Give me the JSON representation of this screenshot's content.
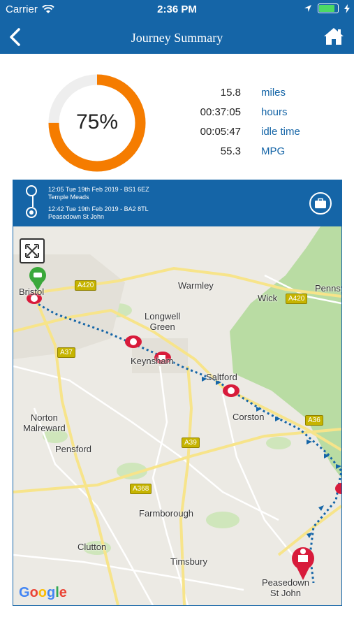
{
  "status_bar": {
    "carrier": "Carrier",
    "time": "2:36 PM",
    "battery_level": 0.9
  },
  "nav": {
    "title": "Journey Summary",
    "back_icon": "chevron-left-icon",
    "home_icon": "home-icon"
  },
  "gauge": {
    "label": "75%",
    "value": 0.75,
    "color": "#f57c00",
    "track_color": "#eeeeee"
  },
  "stats": [
    {
      "value": "15.8",
      "unit": "miles"
    },
    {
      "value": "00:37:05",
      "unit": "hours"
    },
    {
      "value": "00:05:47",
      "unit": "idle time"
    },
    {
      "value": "55.3",
      "unit": "MPG"
    }
  ],
  "route": {
    "start": {
      "time": "12:05 Tue 19th Feb 2019 - BS1 6EZ",
      "place": "Temple Meads"
    },
    "end": {
      "time": "12:42 Tue 19th Feb 2019 - BA2 8TL",
      "place": "Peasedown St John"
    },
    "briefcase_icon": "briefcase-icon"
  },
  "map": {
    "places": {
      "bristol": "Bristol",
      "warmley": "Warmley",
      "longwell_green": "Longwell\nGreen",
      "wick": "Wick",
      "pennsy": "Pennsy",
      "keynsham": "Keynsham",
      "saltford": "Saltford",
      "corston": "Corston",
      "norton_malreward": "Norton\nMalreward",
      "pensford": "Pensford",
      "farmborough": "Farmborough",
      "clutton": "Clutton",
      "timsbury": "Timsbury",
      "peasedown": "Peasedown\nSt John"
    },
    "roads": {
      "a420_west": "A420",
      "a420_east": "A420",
      "a37": "A37",
      "a36": "A36",
      "a39": "A39",
      "a368": "A368"
    },
    "attribution": "Google",
    "route_color": "#1565a7",
    "event_color": "#d81b3b",
    "start_marker_color": "#3aa83a"
  },
  "theme": {
    "primary": "#1565a7",
    "accent": "#f57c00"
  }
}
